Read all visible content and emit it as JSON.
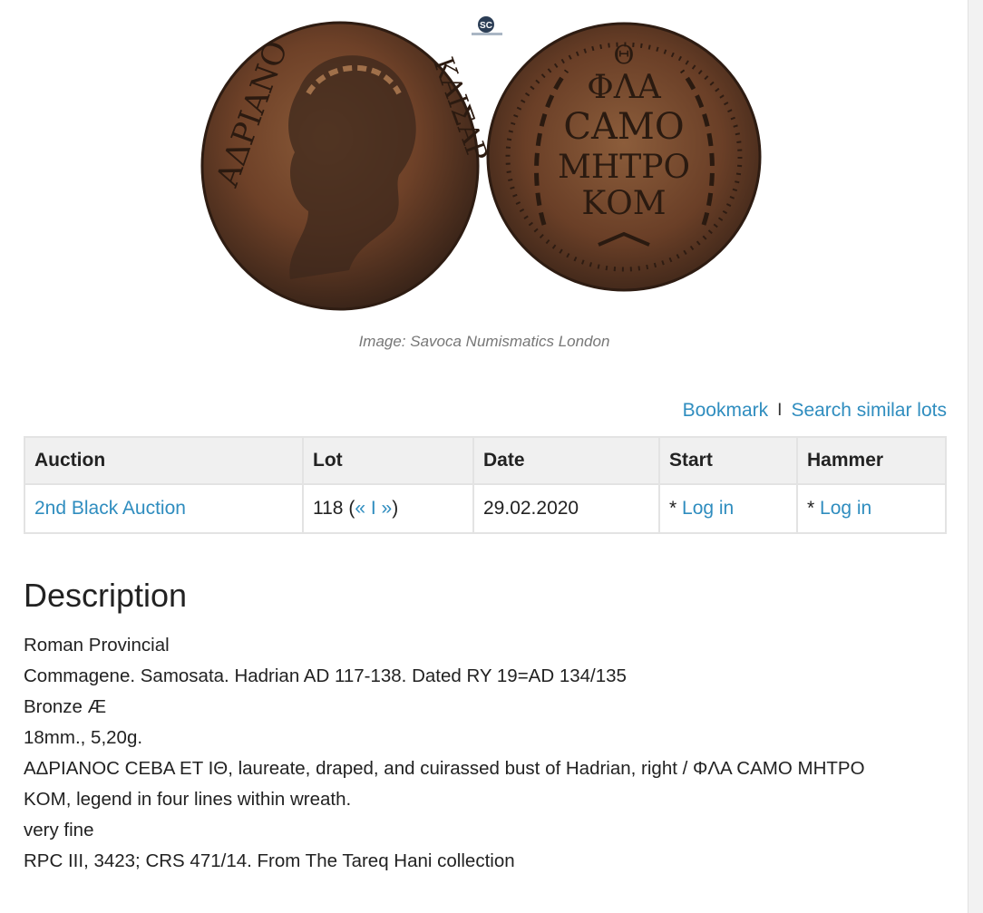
{
  "image": {
    "caption": "Image: Savoca Numismatics London",
    "watermark_logo": "SC",
    "obverse_legend_fragments": [
      "ΑΔΡΙΑΝΟ",
      "ΚΑΙΣΑΡ"
    ],
    "reverse_legend": [
      "Θ",
      "ΦΛΑ",
      "CΑΜΟ",
      "ΜΗΤΡΟ",
      "ΚΟΜ"
    ]
  },
  "actions": {
    "bookmark": "Bookmark",
    "separator": "I",
    "search_similar": "Search similar lots"
  },
  "table": {
    "headers": [
      "Auction",
      "Lot",
      "Date",
      "Start",
      "Hammer"
    ],
    "row": {
      "auction": "2nd Black Auction",
      "lot_number": "118 (",
      "prev": "«",
      "lot_sep": "I",
      "next": "»",
      "lot_close": ")",
      "date": "29.02.2020",
      "start_prefix": "* ",
      "start_link": "Log in",
      "hammer_prefix": "* ",
      "hammer_link": "Log in"
    }
  },
  "description": {
    "title": "Description",
    "lines": [
      "Roman Provincial",
      "Commagene. Samosata. Hadrian AD 117-138. Dated RY 19=AD 134/135",
      "Bronze Æ",
      "18mm., 5,20g.",
      "ΑΔΡΙΑΝΟC CEBA ET IΘ, laureate, draped, and cuirassed bust of Hadrian, right / ΦΛΑ CAMO MHTPO",
      "KOM, legend in four lines within wreath.",
      "very fine",
      "RPC III, 3423; CRS 471/14. From The Tareq Hani collection"
    ]
  },
  "colors": {
    "link": "#2f8dbf",
    "coin_bronze": "#7a4a2e",
    "coin_dark": "#3a2a22"
  }
}
